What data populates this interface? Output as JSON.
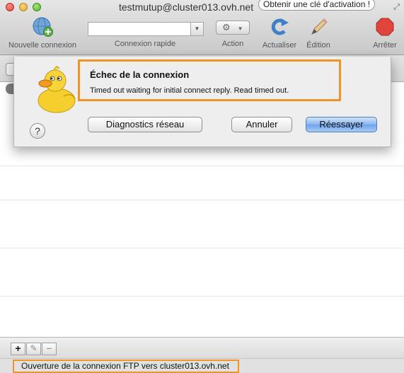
{
  "window": {
    "title": "testmutup@cluster013.ovh.net",
    "activation_button": "Obtenir une clé d'activation !"
  },
  "toolbar": {
    "new_connection": "Nouvelle connexion",
    "quick_connect": "Connexion rapide",
    "quick_connect_value": "",
    "action": "Action",
    "refresh": "Actualiser",
    "edit": "Édition",
    "stop": "Arrêter"
  },
  "dialog": {
    "title": "Échec de la connexion",
    "message": "Timed out waiting for initial connect reply. Read timed out.",
    "help": "?",
    "diagnostics_button": "Diagnostics réseau",
    "cancel_button": "Annuler",
    "retry_button": "Réessayer"
  },
  "bottom_controls": {
    "add": "+",
    "remove": "−"
  },
  "status": {
    "text": "Ouverture de la connexion FTP vers cluster013.ovh.net"
  },
  "colors": {
    "highlight_outline": "#f09428",
    "stop_red": "#e0443a",
    "refresh_blue": "#3f7fc8",
    "default_button_blue": "#6da2e8"
  },
  "icons": {
    "new_connection": "globe-plus-icon",
    "action": "gear-icon",
    "refresh": "refresh-arrow-icon",
    "edit": "pencil-icon",
    "stop": "stop-octagon-icon",
    "app": "cyberduck-duck-icon"
  }
}
